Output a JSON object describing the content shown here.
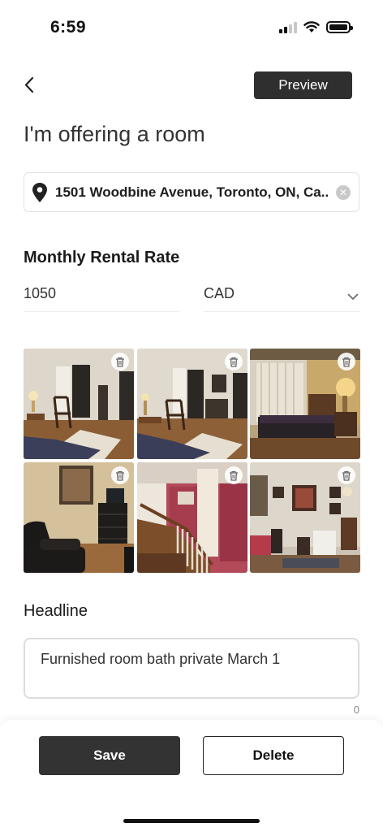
{
  "status_bar": {
    "time": "6:59"
  },
  "header": {
    "preview_label": "Preview",
    "title": "I'm offering a room"
  },
  "address": {
    "value": "1501 Woodbine Avenue, Toronto, ON, Ca...",
    "pin_icon": "location-pin-icon",
    "clear_icon": "clear-circle-icon"
  },
  "rental": {
    "label": "Monthly Rental Rate",
    "amount": "1050",
    "currency": "CAD"
  },
  "photos": [
    {
      "name": "photo-bedroom-rocking-chair-1"
    },
    {
      "name": "photo-bedroom-rocking-chair-2"
    },
    {
      "name": "photo-bedroom-lamp"
    },
    {
      "name": "photo-living-room"
    },
    {
      "name": "photo-staircase"
    },
    {
      "name": "photo-dining-room"
    }
  ],
  "headline": {
    "label": "Headline",
    "value": "Furnished room bath private March 1",
    "char_count": "0"
  },
  "footer": {
    "save_label": "Save",
    "delete_label": "Delete"
  },
  "colors": {
    "primary_button": "#333333",
    "preview_button": "#2f2f2f"
  }
}
